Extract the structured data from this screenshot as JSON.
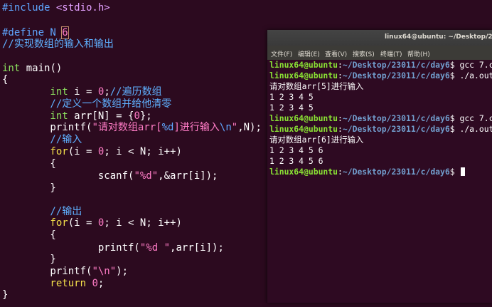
{
  "editor": {
    "l1": {
      "a": "#include ",
      "b": "<stdio.h>"
    },
    "l2": {
      "a": "#define N ",
      "b": "6"
    },
    "l3": "//实现数组的输入和输出",
    "l4": {
      "a": "int",
      "b": " main()"
    },
    "l5": "{",
    "l6": {
      "a": "        int",
      "b": " i = ",
      "c": "0",
      "d": ";",
      "e": "//遍历数组"
    },
    "l7": "        //定义一个数组并给他清零",
    "l8": {
      "a": "        int",
      "b": " arr[N] = {",
      "c": "0",
      "d": "};"
    },
    "l9": {
      "a": "        printf(",
      "b": "\"请对数组arr[",
      "c": "%d",
      "d": "]进行输入",
      "e": "\\n",
      "f": "\"",
      "g": ",N);"
    },
    "l10": "        //输入",
    "l11": {
      "a": "        for",
      "b": "(i = ",
      "c": "0",
      "d": "; i < N; i++)"
    },
    "l12": "        {",
    "l13": {
      "a": "                scanf(",
      "b": "\"%d\"",
      "c": ",&arr[i]);"
    },
    "l14": "        }",
    "l15": "        //输出",
    "l16": {
      "a": "        for",
      "b": "(i = ",
      "c": "0",
      "d": "; i < N; i++)"
    },
    "l17": "        {",
    "l18": {
      "a": "                printf(",
      "b": "\"%d \"",
      "c": ",arr[i]);"
    },
    "l19": "        }",
    "l20": {
      "a": "        printf(",
      "b": "\"\\n\"",
      "c": ");"
    },
    "l21": {
      "a": "        return",
      "b": " ",
      "c": "0",
      "d": ";"
    },
    "l22": "}"
  },
  "terminal": {
    "title": "linux64@ubuntu: ~/Desktop/2301",
    "menu": [
      "文件(F)",
      "编辑(E)",
      "查看(V)",
      "搜索(S)",
      "终端(T)",
      "帮助(H)"
    ],
    "prompt_user": "linux64@ubuntu",
    "prompt_sep": ":",
    "prompt_path": "~/Desktop/23011/c/day6",
    "lines": [
      {
        "cmd": "$ gcc 7.c"
      },
      {
        "cmd": "$ ./a.out"
      },
      {
        "out": "请对数组arr[5]进行输入"
      },
      {
        "out": "1 2 3 4 5"
      },
      {
        "out": "1 2 3 4 5"
      },
      {
        "cmd": "$ gcc 7.c"
      },
      {
        "cmd": "$ ./a.out"
      },
      {
        "out": "请对数组arr[6]进行输入"
      },
      {
        "out": "1 2 3 4 5 6"
      },
      {
        "out": "1 2 3 4 5 6"
      },
      {
        "cmd": "$ "
      }
    ]
  },
  "colors": {
    "editor_bg": "#2c0a1f",
    "terminal_bg": "#2e0a22",
    "prompt_user": "#8ae234",
    "prompt_path": "#729fcf",
    "preprocessor": "#5fa6ff",
    "type": "#8ce05f",
    "keyword": "#f4e04b",
    "number_string": "#ff7cc6"
  }
}
